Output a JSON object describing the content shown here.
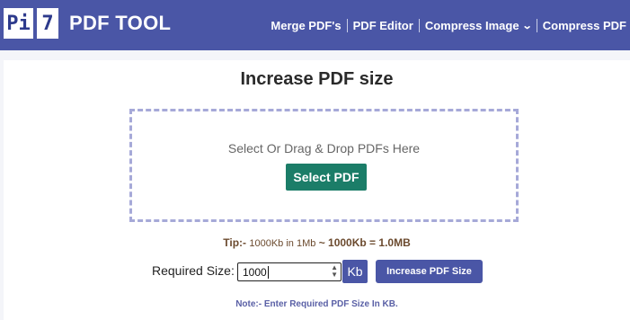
{
  "header": {
    "logo_left": "Pi",
    "logo_right": "7",
    "brand": "PDF TOOL",
    "nav": [
      {
        "label": "Merge PDF's"
      },
      {
        "label": "PDF Editor"
      },
      {
        "label": "Compress Image",
        "has_dropdown": true
      },
      {
        "label": "Compress PDF"
      }
    ],
    "colors": {
      "header_bg": "#4a56a6",
      "accent_green": "#1b7d68"
    }
  },
  "main": {
    "title": "Increase PDF size",
    "dropzone": {
      "text": "Select Or Drag & Drop PDFs Here",
      "button": "Select PDF"
    },
    "tip": {
      "prefix": "Tip:- ",
      "text": "1000Kb in 1Mb",
      "strong": " ~ 1000Kb = 1.0MB"
    },
    "form": {
      "label": "Required Size:",
      "value": "1000",
      "unit": "Kb",
      "submit": "Increase PDF Size"
    },
    "note": "Note:- Enter Required PDF Size In KB."
  }
}
